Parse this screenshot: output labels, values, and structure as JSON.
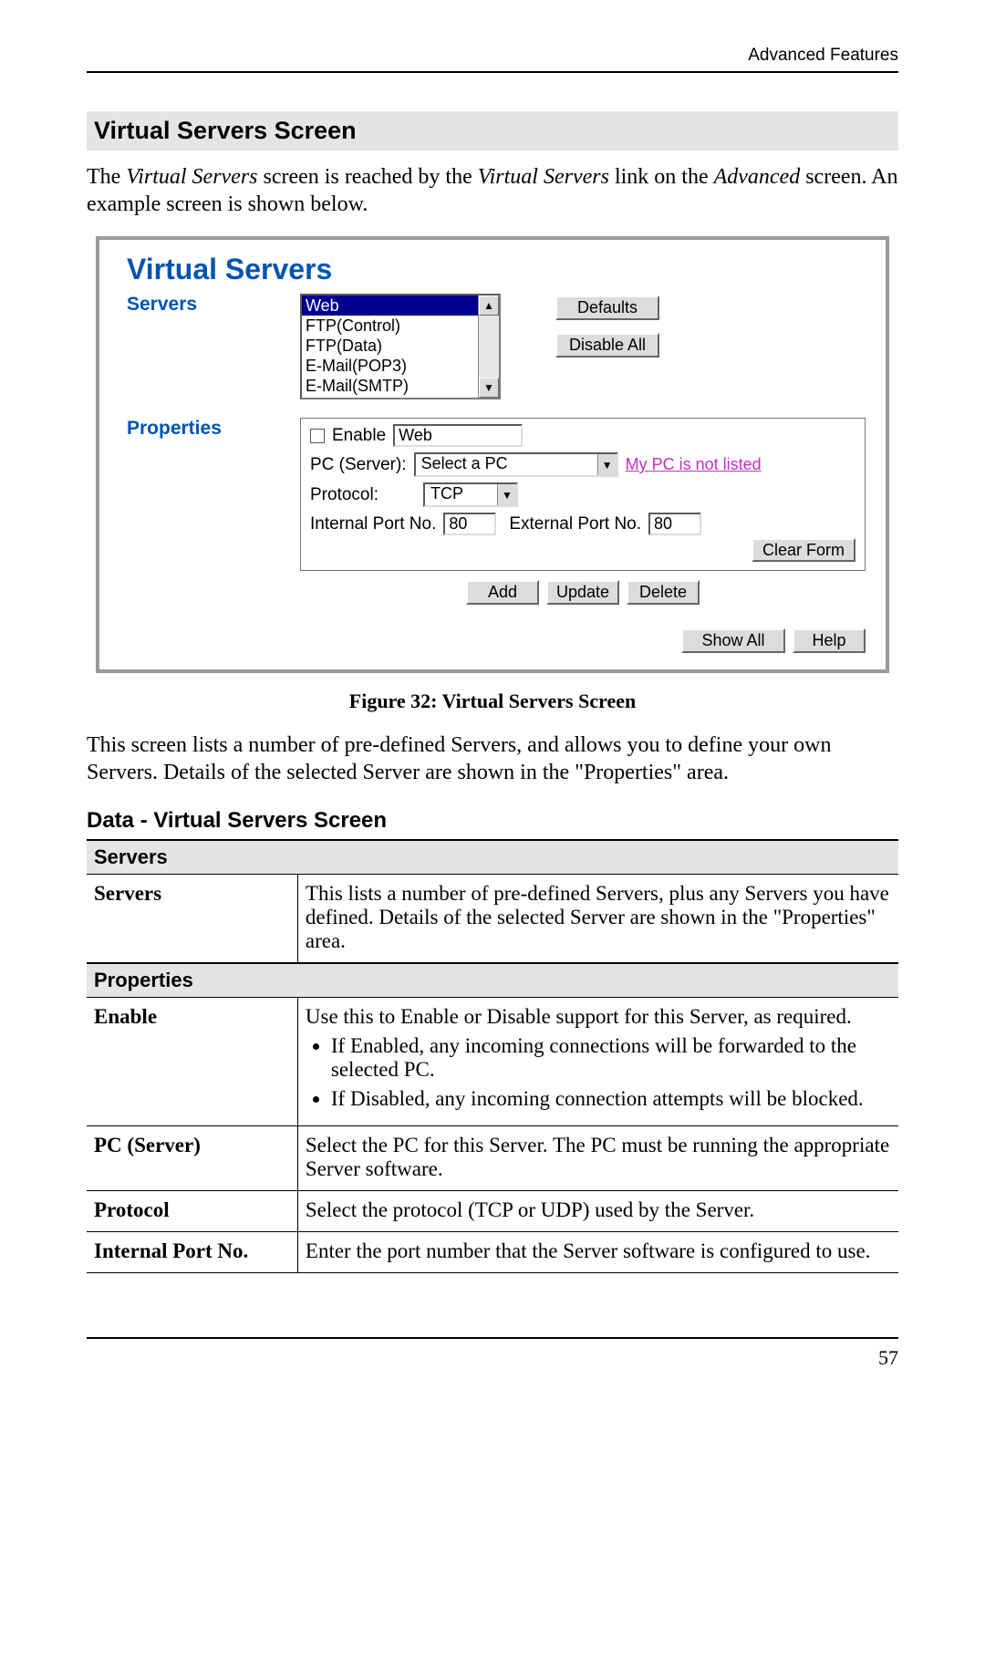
{
  "header": {
    "text": "Advanced Features"
  },
  "section_title": "Virtual Servers Screen",
  "intro": {
    "pre": "The ",
    "i1": "Virtual Servers",
    "mid1": " screen is reached by the ",
    "i2": "Virtual Servers",
    "mid2": " link on the ",
    "i3": "Advanced",
    "post": " screen. An example screen is shown below."
  },
  "screenshot": {
    "title": "Virtual Servers",
    "servers_label": "Servers",
    "server_items": [
      "Web",
      "FTP(Control)",
      "FTP(Data)",
      "E-Mail(POP3)",
      "E-Mail(SMTP)"
    ],
    "defaults_btn": "Defaults",
    "disable_all_btn": "Disable All",
    "properties_label": "Properties",
    "enable_label": "Enable",
    "enable_value": "Web",
    "pc_label": "PC (Server):",
    "pc_value": "Select a PC",
    "pc_link": "My PC is not listed",
    "protocol_label": "Protocol:",
    "protocol_value": "TCP",
    "iport_label": "Internal Port No.",
    "iport_value": "80",
    "eport_label": "External Port No.",
    "eport_value": "80",
    "clear_btn": "Clear Form",
    "add_btn": "Add",
    "update_btn": "Update",
    "delete_btn": "Delete",
    "showall_btn": "Show All",
    "help_btn": "Help"
  },
  "caption": "Figure 32: Virtual Servers Screen",
  "post_text": "This screen lists a number of pre-defined Servers, and allows you to define your own Servers. Details of the selected Server are shown in the \"Properties\" area.",
  "subheading": "Data - Virtual Servers Screen",
  "table": {
    "cat1": "Servers",
    "servers_key": "Servers",
    "servers_val": "This lists a number of pre-defined Servers, plus any Servers you have defined. Details of the selected Server are shown in the \"Properties\" area.",
    "cat2": "Properties",
    "enable_key": "Enable",
    "enable_lead": "Use this to Enable or Disable support for this Server, as required.",
    "enable_b1": "If Enabled, any incoming connections will be forwarded to the selected PC.",
    "enable_b2": "If Disabled, any incoming connection attempts will be blocked.",
    "pc_key": "PC (Server)",
    "pc_val": "Select the PC for this Server. The PC must be running the appropriate Server software.",
    "proto_key": "Protocol",
    "proto_val": "Select the protocol (TCP or UDP) used by the Server.",
    "iport_key": "Internal Port No.",
    "iport_val": "Enter the port number that the Server software is configured to use."
  },
  "page_number": "57"
}
